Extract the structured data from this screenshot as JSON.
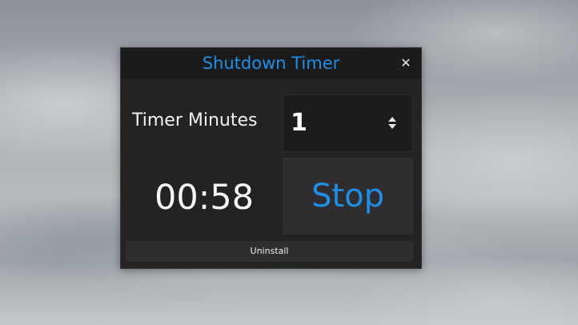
{
  "window": {
    "title": "Shutdown Timer",
    "close_glyph": "✕",
    "close_icon": "close-icon"
  },
  "timer": {
    "minutes_label": "Timer Minutes",
    "minutes_value": "1",
    "spinner_icon": "up-down-spinner-icon",
    "countdown": "00:58"
  },
  "buttons": {
    "stop_label": "Stop",
    "uninstall_label": "Uninstall"
  },
  "colors": {
    "accent": "#1f8fe6",
    "window_bg": "#242223",
    "button_bg": "#2f2d2f"
  }
}
